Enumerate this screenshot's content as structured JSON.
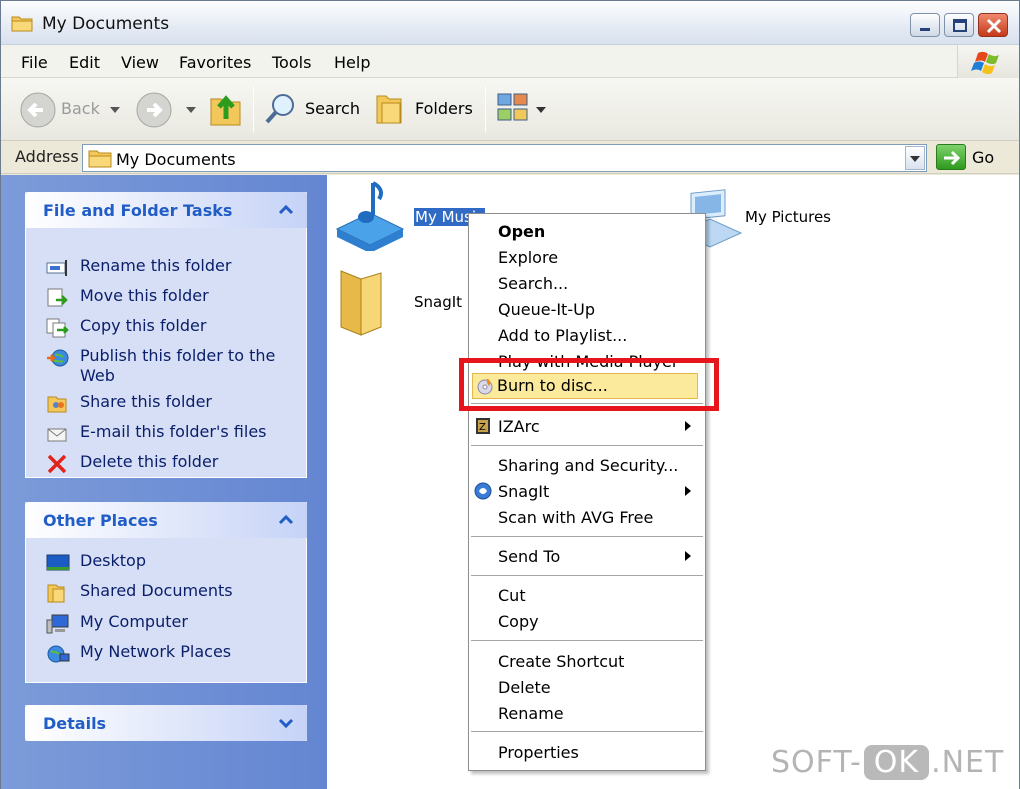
{
  "window": {
    "title": "My Documents"
  },
  "menubar": {
    "items": [
      "File",
      "Edit",
      "View",
      "Favorites",
      "Tools",
      "Help"
    ]
  },
  "toolbar": {
    "back": "Back",
    "search": "Search",
    "folders": "Folders"
  },
  "address": {
    "label": "Address",
    "value": "My Documents",
    "go": "Go"
  },
  "left_pane": {
    "file_tasks": {
      "title": "File and Folder Tasks",
      "items": [
        {
          "label": "Rename this folder",
          "icon": "rename-icon"
        },
        {
          "label": "Move this folder",
          "icon": "move-icon"
        },
        {
          "label": "Copy this folder",
          "icon": "copy-icon"
        },
        {
          "label": "Publish this folder to the",
          "label2": "Web",
          "icon": "publish-icon"
        },
        {
          "label": "Share this folder",
          "icon": "share-icon"
        },
        {
          "label": "E-mail this folder's files",
          "icon": "email-icon"
        },
        {
          "label": "Delete this folder",
          "icon": "delete-icon"
        }
      ]
    },
    "other_places": {
      "title": "Other Places",
      "items": [
        {
          "label": "Desktop",
          "icon": "desktop-icon"
        },
        {
          "label": "Shared Documents",
          "icon": "folder-icon"
        },
        {
          "label": "My Computer",
          "icon": "computer-icon"
        },
        {
          "label": "My Network Places",
          "icon": "network-icon"
        }
      ]
    },
    "details": {
      "title": "Details"
    }
  },
  "content": {
    "items": [
      {
        "label": "My Music",
        "icon": "music-folder-icon",
        "selected": true
      },
      {
        "label": "My Pictures",
        "icon": "pictures-folder-icon"
      },
      {
        "label": "SnagIt",
        "icon": "folder-icon"
      }
    ]
  },
  "context_menu": {
    "items": {
      "open": "Open",
      "explore": "Explore",
      "search": "Search...",
      "queue": "Queue-It-Up",
      "playlist": "Add to Playlist...",
      "mediaplayer": "Play with Media Player",
      "burn": "Burn to disc...",
      "izarc": "IZArc",
      "sharing": "Sharing and Security...",
      "snagit": "SnagIt",
      "avg": "Scan with AVG Free",
      "sendto": "Send To",
      "cut": "Cut",
      "copy": "Copy",
      "shortcut": "Create Shortcut",
      "delete": "Delete",
      "rename": "Rename",
      "properties": "Properties"
    },
    "highlighted": "Burn to disc..."
  },
  "watermark": {
    "left": "SOFT-",
    "box": "OK",
    "right": ".NET"
  },
  "colors": {
    "accent_red": "#e8141b",
    "selection": "#316ac5",
    "panel_title": "#215dc6"
  }
}
